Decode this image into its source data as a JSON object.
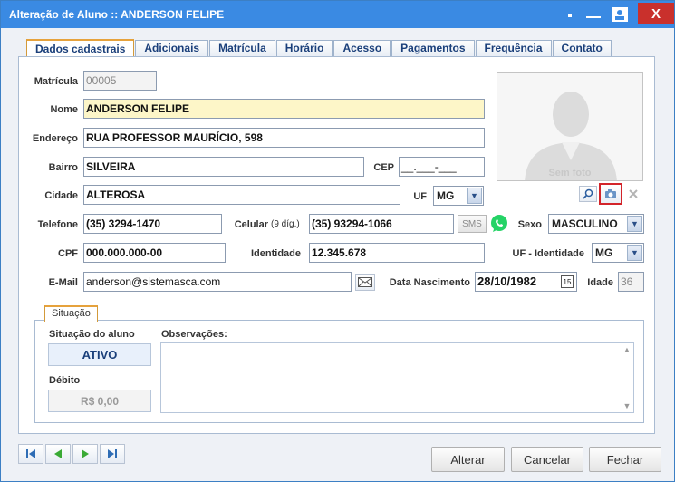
{
  "window": {
    "title": "Alteração de Aluno :: ANDERSON FELIPE",
    "close_label": "X"
  },
  "tabs": [
    {
      "label": "Dados cadastrais"
    },
    {
      "label": "Adicionais"
    },
    {
      "label": "Matrícula"
    },
    {
      "label": "Horário"
    },
    {
      "label": "Acesso"
    },
    {
      "label": "Pagamentos"
    },
    {
      "label": "Frequência"
    },
    {
      "label": "Contato"
    }
  ],
  "form": {
    "matricula": {
      "label": "Matrícula",
      "value": "00005"
    },
    "nome": {
      "label": "Nome",
      "value": "ANDERSON FELIPE"
    },
    "endereco": {
      "label": "Endereço",
      "value": "RUA PROFESSOR MAURÍCIO, 598"
    },
    "bairro": {
      "label": "Bairro",
      "value": "SILVEIRA"
    },
    "cep": {
      "label": "CEP",
      "value": "__.___-___"
    },
    "cidade": {
      "label": "Cidade",
      "value": "ALTEROSA"
    },
    "uf": {
      "label": "UF",
      "value": "MG"
    },
    "telefone": {
      "label": "Telefone",
      "value": "(35) 3294-1470"
    },
    "celular": {
      "label": "Celular",
      "hint": "(9 díg.)",
      "value": "(35) 93294-1066"
    },
    "sms_label": "SMS",
    "sexo": {
      "label": "Sexo",
      "value": "MASCULINO"
    },
    "cpf": {
      "label": "CPF",
      "value": "000.000.000-00"
    },
    "identidade": {
      "label": "Identidade",
      "value": "12.345.678"
    },
    "uf_identidade": {
      "label": "UF - Identidade",
      "value": "MG"
    },
    "email": {
      "label": "E-Mail",
      "value": "anderson@sistemasca.com"
    },
    "nascimento": {
      "label": "Data Nascimento",
      "value": "28/10/1982",
      "calendar": "15"
    },
    "idade": {
      "label": "Idade",
      "value": "36"
    }
  },
  "photo": {
    "placeholder": "Sem foto"
  },
  "situacao": {
    "group_label": "Situação",
    "status_label": "Situação do aluno",
    "status_value": "ATIVO",
    "debito_label": "Débito",
    "debito_value": "R$ 0,00",
    "obs_label": "Observações:"
  },
  "buttons": {
    "alterar": "Alterar",
    "cancelar": "Cancelar",
    "fechar": "Fechar"
  },
  "colors": {
    "title_bar": "#3a8ae3",
    "close": "#c9302c",
    "highlight": "#fdf6c8",
    "status": "#1a3f7a",
    "whatsapp": "#25d366"
  }
}
